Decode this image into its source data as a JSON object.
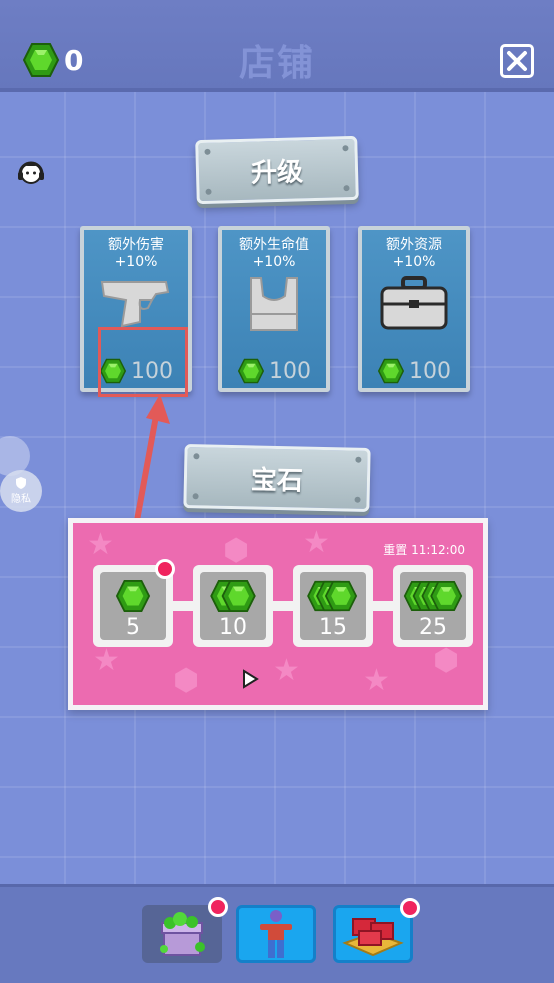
{
  "header": {
    "gem_count": "0",
    "title": "店铺",
    "gem_icon": "green-gem-icon",
    "close_icon": "close-icon"
  },
  "upgrade_section": {
    "title": "升级",
    "items": [
      {
        "name": "额外伤害",
        "bonus": "+10%",
        "price": "100",
        "icon": "pistol-icon"
      },
      {
        "name": "额外生命值",
        "bonus": "+10%",
        "price": "100",
        "icon": "vest-icon"
      },
      {
        "name": "额外资源",
        "bonus": "+10%",
        "price": "100",
        "icon": "toolbox-icon"
      }
    ]
  },
  "gem_section": {
    "title": "宝石",
    "reset_text": "重置 11:12:00",
    "rewards": [
      {
        "amount": "5",
        "gems_shown": 1,
        "has_notification": true
      },
      {
        "amount": "10",
        "gems_shown": 2,
        "has_notification": false
      },
      {
        "amount": "15",
        "gems_shown": 3,
        "has_notification": false
      },
      {
        "amount": "25",
        "gems_shown": 4,
        "has_notification": false
      }
    ]
  },
  "side": {
    "privacy_label": "隐私"
  },
  "bottom_tabs": [
    {
      "name": "gem-chest",
      "icon": "gem-chest-icon",
      "active": true,
      "has_notification": true
    },
    {
      "name": "character",
      "icon": "character-icon",
      "active": false,
      "has_notification": false
    },
    {
      "name": "weapons",
      "icon": "weapon-crate-icon",
      "active": false,
      "has_notification": true
    }
  ],
  "colors": {
    "background": "#7b8fd9",
    "card_blue": "#3c82b5",
    "panel_pink": "#ec6bb0",
    "gem_green": "#39b21c",
    "notification_red": "#f0245e"
  }
}
